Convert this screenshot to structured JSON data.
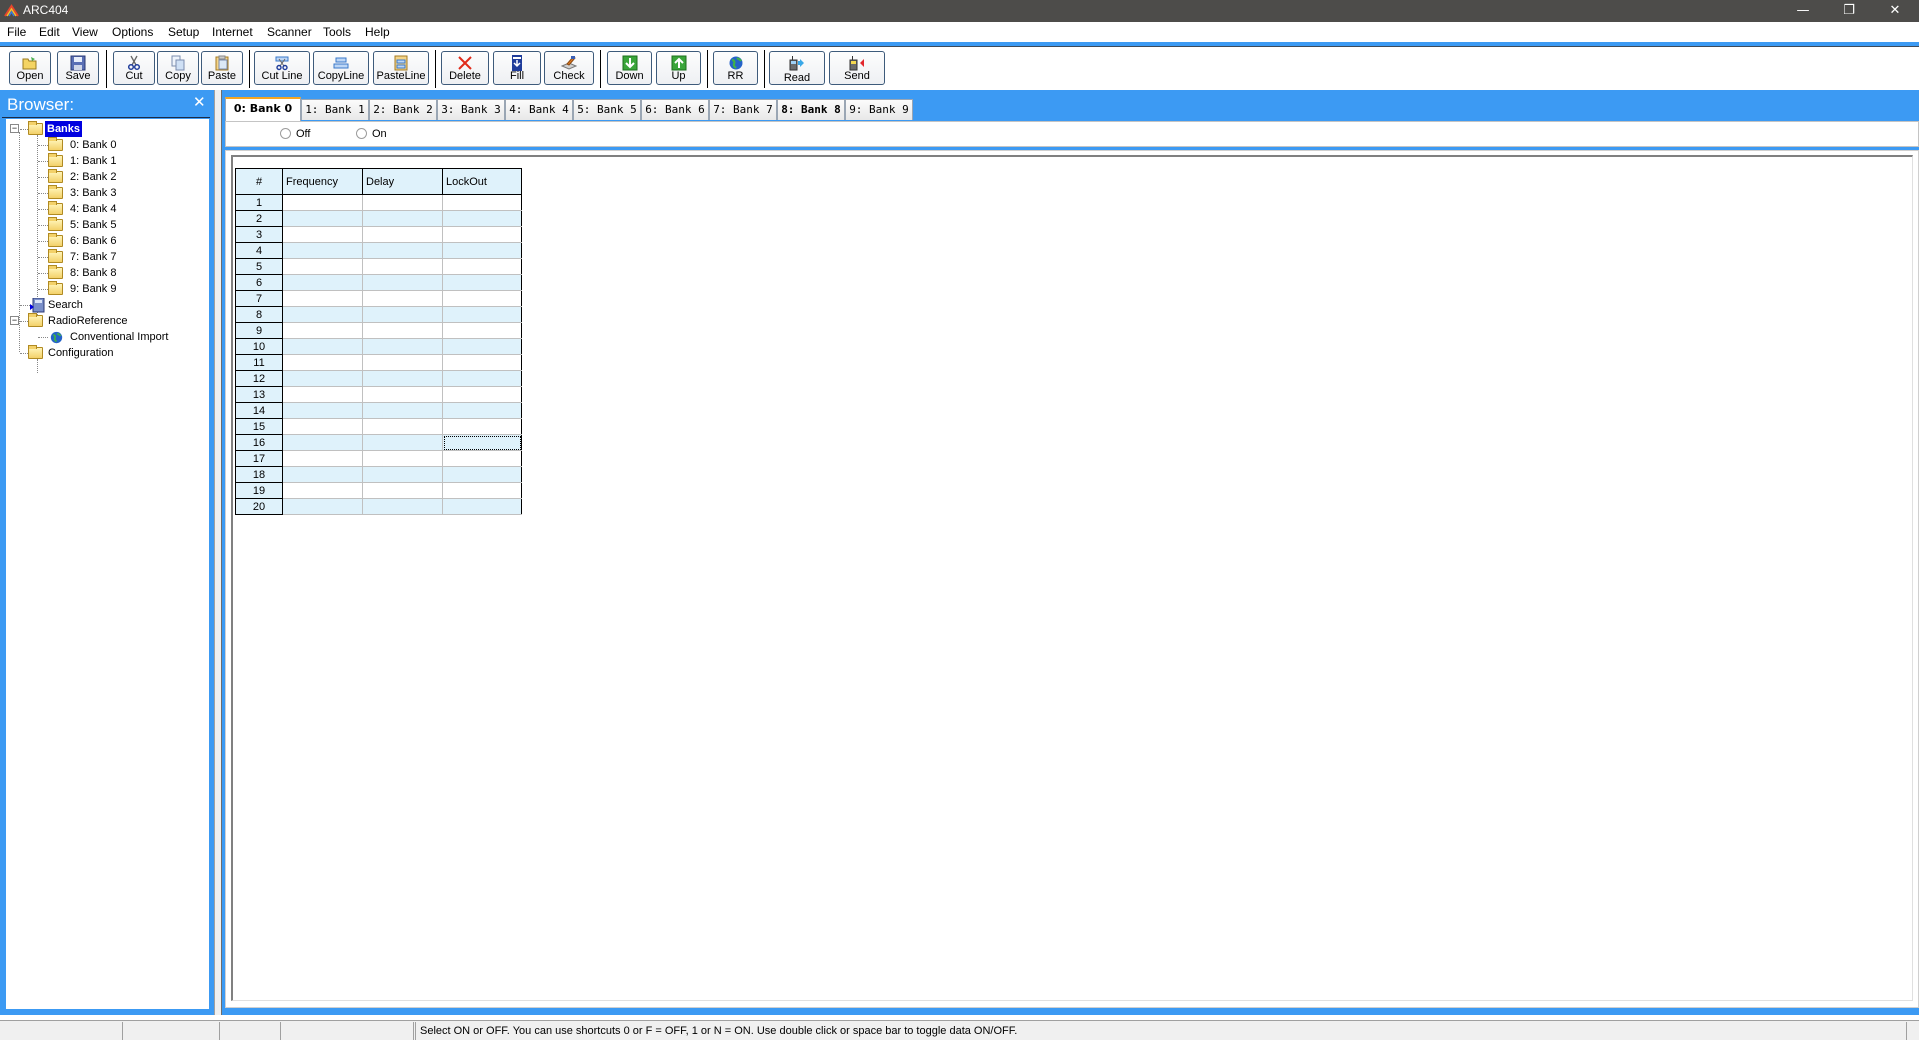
{
  "window": {
    "title": "ARC404",
    "controls": {
      "minimize": "—",
      "maximize": "❐",
      "close": "✕"
    }
  },
  "menu": [
    "File",
    "Edit",
    "View",
    "Options",
    "Setup",
    "Internet",
    "Scanner",
    "Tools",
    "Help"
  ],
  "toolbar": {
    "buttons": [
      {
        "label": "Open",
        "icon": "open-folder-icon"
      },
      {
        "label": "Save",
        "icon": "floppy-disk-icon"
      },
      {
        "label": "Cut",
        "icon": "scissors-icon"
      },
      {
        "label": "Copy",
        "icon": "copy-icon"
      },
      {
        "label": "Paste",
        "icon": "paste-icon"
      },
      {
        "label": "Cut Line",
        "icon": "cut-line-icon"
      },
      {
        "label": "CopyLine",
        "icon": "copy-line-icon"
      },
      {
        "label": "PasteLine",
        "icon": "paste-line-icon"
      },
      {
        "label": "Delete",
        "icon": "delete-x-icon"
      },
      {
        "label": "Fill",
        "icon": "fill-down-icon"
      },
      {
        "label": "Check",
        "icon": "check-brush-icon"
      },
      {
        "label": "Down",
        "icon": "arrow-down-icon"
      },
      {
        "label": "Up",
        "icon": "arrow-up-icon"
      },
      {
        "label": "RR",
        "icon": "globe-icon"
      },
      {
        "label": "Read",
        "icon": "read-from-radio-icon"
      },
      {
        "label": "Send",
        "icon": "send-to-radio-icon"
      }
    ]
  },
  "browser": {
    "title": "Browser:",
    "close": "✕",
    "tree": {
      "root": "Banks",
      "banks": [
        "0: Bank 0",
        "1: Bank 1",
        "2: Bank 2",
        "3: Bank 3",
        "4: Bank 4",
        "5: Bank 5",
        "6: Bank 6",
        "7: Bank 7",
        "8: Bank 8",
        "9: Bank 9"
      ],
      "search": "Search",
      "radioreference": "RadioReference",
      "conventional_import": "Conventional Import",
      "configuration": "Configuration",
      "expander_glyph": "−"
    }
  },
  "tabs": {
    "active_index": 0,
    "items": [
      "0: Bank 0",
      "1: Bank 1",
      "2: Bank 2",
      "3: Bank 3",
      "4: Bank 4",
      "5: Bank 5",
      "6: Bank 6",
      "7: Bank 7",
      "8: Bank 8",
      "9: Bank 9"
    ]
  },
  "bank_toggle": {
    "options": [
      "Off",
      "On"
    ],
    "selected": null
  },
  "grid": {
    "columns": [
      "#",
      "Frequency",
      "Delay",
      "LockOut"
    ],
    "rows": [
      {
        "n": "1",
        "frequency": "",
        "delay": "",
        "lockout": ""
      },
      {
        "n": "2",
        "frequency": "",
        "delay": "",
        "lockout": ""
      },
      {
        "n": "3",
        "frequency": "",
        "delay": "",
        "lockout": ""
      },
      {
        "n": "4",
        "frequency": "",
        "delay": "",
        "lockout": ""
      },
      {
        "n": "5",
        "frequency": "",
        "delay": "",
        "lockout": ""
      },
      {
        "n": "6",
        "frequency": "",
        "delay": "",
        "lockout": ""
      },
      {
        "n": "7",
        "frequency": "",
        "delay": "",
        "lockout": ""
      },
      {
        "n": "8",
        "frequency": "",
        "delay": "",
        "lockout": ""
      },
      {
        "n": "9",
        "frequency": "",
        "delay": "",
        "lockout": ""
      },
      {
        "n": "10",
        "frequency": "",
        "delay": "",
        "lockout": ""
      },
      {
        "n": "11",
        "frequency": "",
        "delay": "",
        "lockout": ""
      },
      {
        "n": "12",
        "frequency": "",
        "delay": "",
        "lockout": ""
      },
      {
        "n": "13",
        "frequency": "",
        "delay": "",
        "lockout": ""
      },
      {
        "n": "14",
        "frequency": "",
        "delay": "",
        "lockout": ""
      },
      {
        "n": "15",
        "frequency": "",
        "delay": "",
        "lockout": ""
      },
      {
        "n": "16",
        "frequency": "",
        "delay": "",
        "lockout": ""
      },
      {
        "n": "17",
        "frequency": "",
        "delay": "",
        "lockout": ""
      },
      {
        "n": "18",
        "frequency": "",
        "delay": "",
        "lockout": ""
      },
      {
        "n": "19",
        "frequency": "",
        "delay": "",
        "lockout": ""
      },
      {
        "n": "20",
        "frequency": "",
        "delay": "",
        "lockout": ""
      }
    ],
    "focused_cell": {
      "row": "16",
      "column": "LockOut"
    }
  },
  "statusbar": {
    "panels": [
      "",
      "",
      "",
      "",
      "Select ON or OFF. You can use shortcuts 0 or F = OFF, 1 or N = ON. Use double click or space bar to toggle data ON/OFF."
    ]
  },
  "colors": {
    "accent_blue": "#3c9af3",
    "titlebar": "#4d4c4a",
    "row_alt": "#dff2fb",
    "selection": "#0000e0",
    "active_tab_top": "#f5a623"
  }
}
